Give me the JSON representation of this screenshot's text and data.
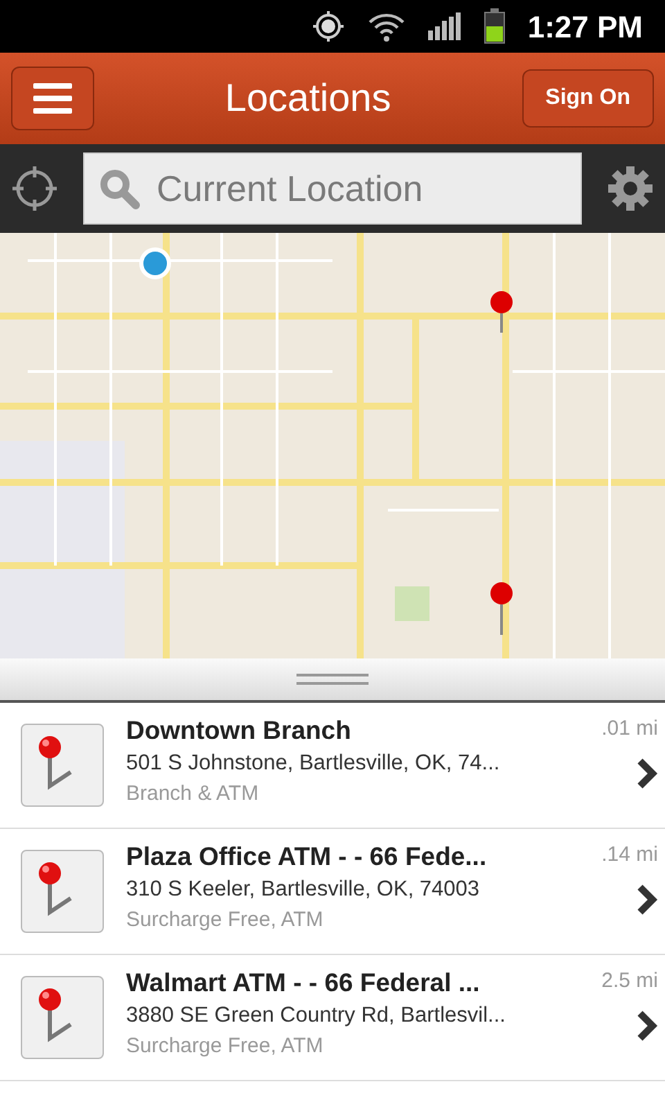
{
  "status_bar": {
    "time": "1:27 PM"
  },
  "header": {
    "title": "Locations",
    "sign_on": "Sign On"
  },
  "search": {
    "placeholder": "Current Location"
  },
  "locations": [
    {
      "name": "Downtown Branch",
      "address": "501 S Johnstone, Bartlesville, OK, 74...",
      "tags": "Branch & ATM",
      "distance": ".01 mi"
    },
    {
      "name": "Plaza Office ATM - - 66 Fede...",
      "address": "310 S Keeler, Bartlesville, OK, 74003",
      "tags": "Surcharge Free, ATM",
      "distance": ".14 mi"
    },
    {
      "name": "Walmart ATM - - 66 Federal ...",
      "address": "3880 SE Green Country Rd, Bartlesvil...",
      "tags": "Surcharge Free, ATM",
      "distance": "2.5 mi"
    }
  ]
}
